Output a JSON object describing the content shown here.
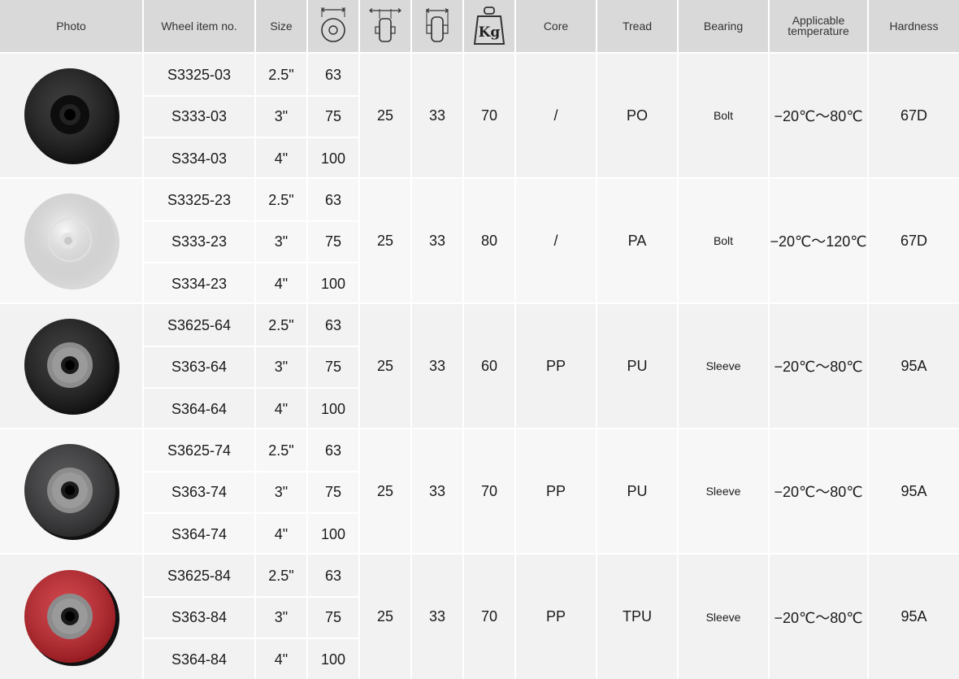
{
  "header": {
    "photo": "Photo",
    "item_no": "Wheel item no.",
    "size": "Size",
    "diameter_icon": "wheel-diameter-icon",
    "width_icon": "wheel-width-icon",
    "length_icon": "hub-length-icon",
    "load_icon": "load-weight-icon",
    "load_icon_text": "Kg",
    "core": "Core",
    "tread": "Tread",
    "bearing": "Bearing",
    "temp_line1": "Applicable",
    "temp_line2": "temperature",
    "hardness": "Hardness"
  },
  "groups": [
    {
      "wheel_color": "#1a1a1a",
      "wheel_image": "black-wheel-image",
      "rows": [
        {
          "item": "S3325-03",
          "size": "2.5\"",
          "diameter": "63"
        },
        {
          "item": "S333-03",
          "size": "3\"",
          "diameter": "75"
        },
        {
          "item": "S334-03",
          "size": "4\"",
          "diameter": "100"
        }
      ],
      "width": "25",
      "length": "33",
      "load": "70",
      "core": "/",
      "tread": "PO",
      "bearing": "Bolt",
      "temperature": "−20℃～80℃",
      "hardness": "67D"
    },
    {
      "wheel_color": "#f4f4f4",
      "wheel_image": "white-wheel-image",
      "rows": [
        {
          "item": "S3325-23",
          "size": "2.5\"",
          "diameter": "63"
        },
        {
          "item": "S333-23",
          "size": "3\"",
          "diameter": "75"
        },
        {
          "item": "S334-23",
          "size": "4\"",
          "diameter": "100"
        }
      ],
      "width": "25",
      "length": "33",
      "load": "80",
      "core": "/",
      "tread": "PA",
      "bearing": "Bolt",
      "temperature": "−20℃～120℃",
      "hardness": "67D"
    },
    {
      "wheel_color": "#1c1c1c",
      "wheel_image": "black-grey-wheel-image",
      "rows": [
        {
          "item": "S3625-64",
          "size": "2.5\"",
          "diameter": "63"
        },
        {
          "item": "S363-64",
          "size": "3\"",
          "diameter": "75"
        },
        {
          "item": "S364-64",
          "size": "4\"",
          "diameter": "100"
        }
      ],
      "width": "25",
      "length": "33",
      "load": "60",
      "core": "PP",
      "tread": "PU",
      "bearing": "Sleeve",
      "temperature": "−20℃～80℃",
      "hardness": "95A"
    },
    {
      "wheel_color": "#3a3a3c",
      "wheel_image": "dark-grey-wheel-image",
      "rows": [
        {
          "item": "S3625-74",
          "size": "2.5\"",
          "diameter": "63"
        },
        {
          "item": "S363-74",
          "size": "3\"",
          "diameter": "75"
        },
        {
          "item": "S364-74",
          "size": "4\"",
          "diameter": "100"
        }
      ],
      "width": "25",
      "length": "33",
      "load": "70",
      "core": "PP",
      "tread": "PU",
      "bearing": "Sleeve",
      "temperature": "−20℃～80℃",
      "hardness": "95A"
    },
    {
      "wheel_color": "#c8252c",
      "wheel_image": "red-wheel-image",
      "rows": [
        {
          "item": "S3625-84",
          "size": "2.5\"",
          "diameter": "63"
        },
        {
          "item": "S363-84",
          "size": "3\"",
          "diameter": "75"
        },
        {
          "item": "S364-84",
          "size": "4\"",
          "diameter": "100"
        }
      ],
      "width": "25",
      "length": "33",
      "load": "70",
      "core": "PP",
      "tread": "TPU",
      "bearing": "Sleeve",
      "temperature": "−20℃～80℃",
      "hardness": "95A"
    }
  ]
}
